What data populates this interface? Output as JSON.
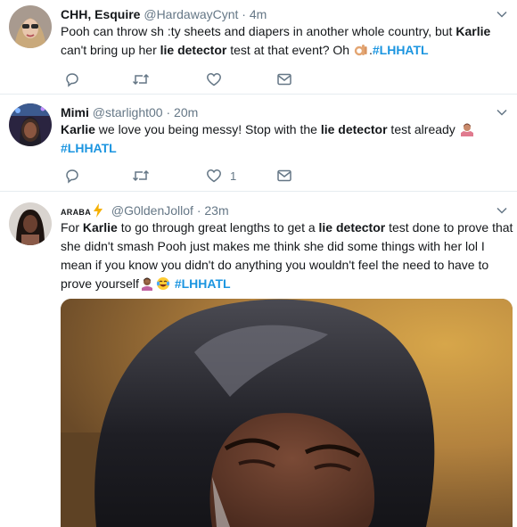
{
  "tweets": [
    {
      "name": "CHH, Esquire",
      "handle": "@HardawayCynt",
      "dot": "·",
      "time": "4m",
      "text": {
        "p1": "Pooh can throw sh :ty sheets and diapers in another whole country, but ",
        "b1": "Karlie",
        "p2": " can't bring up her ",
        "b2": "lie detector",
        "p3": " test at that event? Oh ",
        "p4": ".",
        "hashtag": "#LHHATL"
      },
      "emoji": "ok-hand",
      "likes": ""
    },
    {
      "name": "Mimi",
      "handle": "@starlight00",
      "dot": "·",
      "time": "20m",
      "text": {
        "b1": "Karlie",
        "p1": " we love you being messy! Stop with the ",
        "b2": "lie detector",
        "p2": " test already ",
        "hashtag": "#LHHATL"
      },
      "emoji": "woman-shrugging",
      "likes": "1"
    },
    {
      "name": "ARABA",
      "handle": "@G0ldenJollof",
      "dot": "·",
      "time": "23m",
      "text": {
        "p1": "For ",
        "b1": "Karlie",
        "p2": " to go through great lengths to get a ",
        "b2": "lie detector",
        "p3": " test done to prove that she didn't smash Pooh just makes me think she did some things with her lol I mean if you know you didn't do anything you wouldn't feel the need to have to prove yourself",
        "hashtag": "#LHHATL"
      },
      "emojis": [
        "woman-facepalming",
        "face-with-tears-of-joy"
      ],
      "name_icon": "lightning-icon",
      "media": "photo of a crying woman"
    }
  ],
  "colors": {
    "accent": "#1b95e0",
    "secondary_text": "#657786",
    "divider": "#e6ecf0"
  }
}
